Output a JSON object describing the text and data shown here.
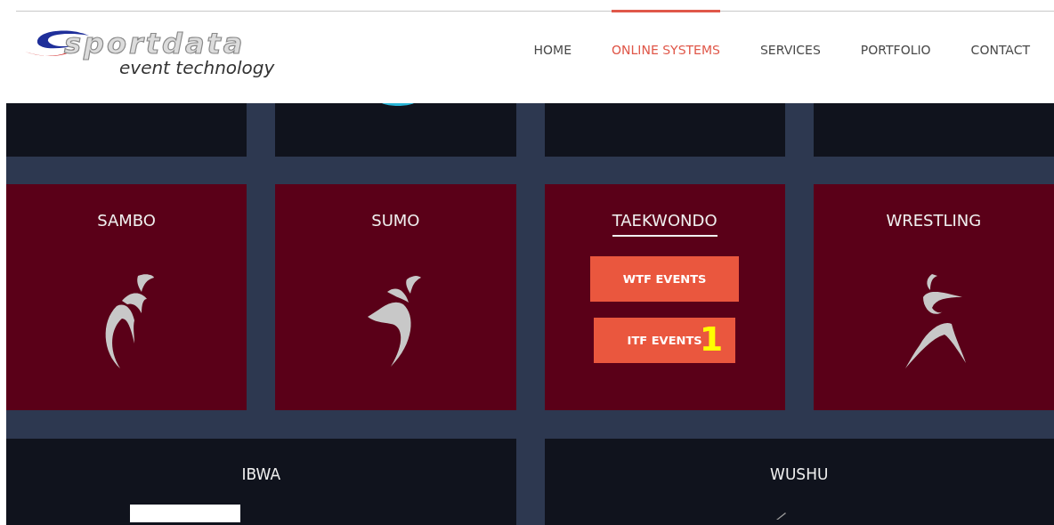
{
  "header": {
    "logo": {
      "wordmark": "sportdata",
      "tagline": "event technology"
    },
    "nav": [
      {
        "label": "HOME",
        "selected": false
      },
      {
        "label": "ONLINE SYSTEMS",
        "selected": true
      },
      {
        "label": "SERVICES",
        "selected": false
      },
      {
        "label": "PORTFOLIO",
        "selected": false
      },
      {
        "label": "CONTACT",
        "selected": false
      }
    ]
  },
  "top_row": [
    {
      "kind": "blank"
    },
    {
      "kind": "icon_partial"
    },
    {
      "kind": "blank"
    },
    {
      "kind": "blank"
    }
  ],
  "sports": [
    {
      "title": "SAMBO",
      "selected": false,
      "kind": "throw"
    },
    {
      "title": "SUMO",
      "selected": false,
      "kind": "push"
    },
    {
      "title": "TAEKWONDO",
      "selected": true,
      "kind": "buttons",
      "buttons": [
        {
          "label": "WTF EVENTS"
        },
        {
          "label": "ITF EVENTS",
          "badge": "1"
        }
      ]
    },
    {
      "title": "WRESTLING",
      "selected": false,
      "kind": "kick"
    }
  ],
  "bottom_row": [
    {
      "title": "IBWA",
      "kind": "logo_partial"
    },
    {
      "title": "WUSHU",
      "kind": "figure_partial"
    }
  ]
}
